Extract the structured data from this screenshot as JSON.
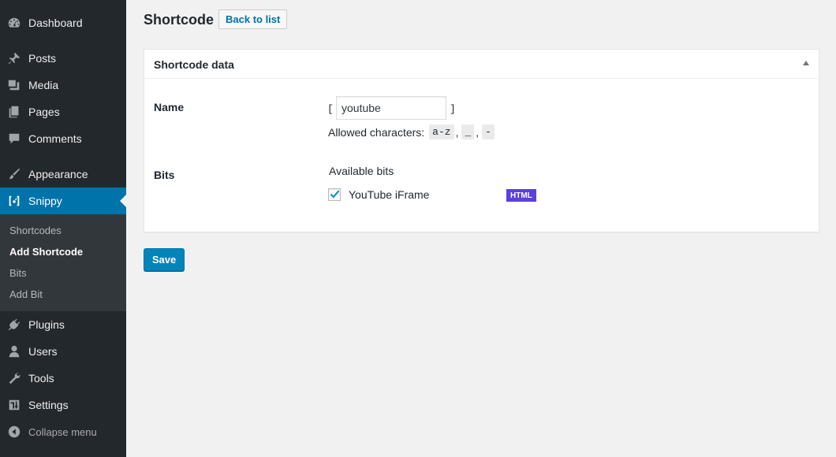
{
  "sidebar": {
    "menu": [
      {
        "label": "Dashboard",
        "icon": "dashboard-icon"
      },
      {
        "label": "Posts",
        "icon": "pin-icon"
      },
      {
        "label": "Media",
        "icon": "media-icon"
      },
      {
        "label": "Pages",
        "icon": "pages-icon"
      },
      {
        "label": "Comments",
        "icon": "comment-icon"
      },
      {
        "label": "Appearance",
        "icon": "brush-icon"
      },
      {
        "label": "Snippy",
        "icon": "snippy-icon",
        "active": true
      },
      {
        "label": "Plugins",
        "icon": "plugin-icon"
      },
      {
        "label": "Users",
        "icon": "user-icon"
      },
      {
        "label": "Tools",
        "icon": "wrench-icon"
      },
      {
        "label": "Settings",
        "icon": "settings-icon"
      }
    ],
    "submenu": [
      {
        "label": "Shortcodes"
      },
      {
        "label": "Add Shortcode",
        "current": true
      },
      {
        "label": "Bits"
      },
      {
        "label": "Add Bit"
      }
    ],
    "collapse_label": "Collapse menu"
  },
  "header": {
    "title": "Shortcode",
    "back_label": "Back to list"
  },
  "postbox": {
    "title": "Shortcode data",
    "name_label": "Name",
    "bracket_open": "[",
    "bracket_close": "]",
    "name_value": "youtube",
    "allowed_text": "Allowed characters:",
    "allowed_codes": [
      "a-z",
      "_",
      "-"
    ],
    "comma": ",",
    "bits_label": "Bits",
    "available_bits": "Available bits",
    "bit": {
      "name": "YouTube iFrame",
      "badge": "HTML",
      "checked": true
    }
  },
  "save_label": "Save",
  "colors": {
    "accent": "#0073aa",
    "sidebar": "#23282d",
    "badge": "#5b3fe0"
  }
}
